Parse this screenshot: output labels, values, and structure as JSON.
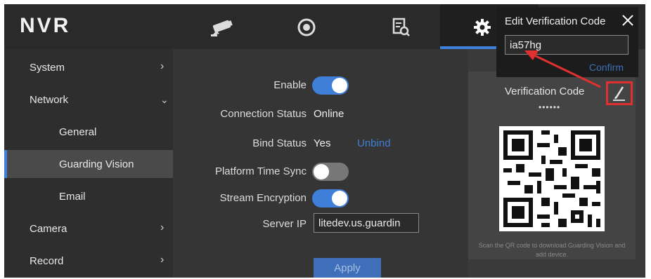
{
  "app": {
    "logo": "NVR"
  },
  "header": {
    "tabs": [
      {
        "icon": "camera-icon"
      },
      {
        "icon": "playback-icon"
      },
      {
        "icon": "search-file-icon"
      },
      {
        "icon": "gear-icon",
        "active": true
      }
    ]
  },
  "sidebar": {
    "items": [
      {
        "label": "System"
      },
      {
        "label": "Network"
      },
      {
        "label": "General"
      },
      {
        "label": "Guarding Vision"
      },
      {
        "label": "Email"
      },
      {
        "label": "Camera"
      },
      {
        "label": "Record"
      }
    ]
  },
  "form": {
    "enable_label": "Enable",
    "enable_on": true,
    "connection_label": "Connection Status",
    "connection_value": "Online",
    "bind_label": "Bind Status",
    "bind_value": "Yes",
    "unbind_link": "Unbind",
    "time_sync_label": "Platform Time Sync",
    "time_sync_on": false,
    "encryption_label": "Stream Encryption",
    "encryption_on": true,
    "server_label": "Server IP",
    "server_value": "litedev.us.guardin",
    "apply_label": "Apply"
  },
  "verification": {
    "label": "Verification Code",
    "masked": "••••••",
    "qr_note": "Scan the QR code to download Guarding Vision and add device."
  },
  "popup": {
    "title": "Edit Verification Code",
    "value": "ia57hg",
    "confirm_label": "Confirm"
  },
  "colors": {
    "accent": "#3f7fd9",
    "highlight": "#e03030"
  }
}
